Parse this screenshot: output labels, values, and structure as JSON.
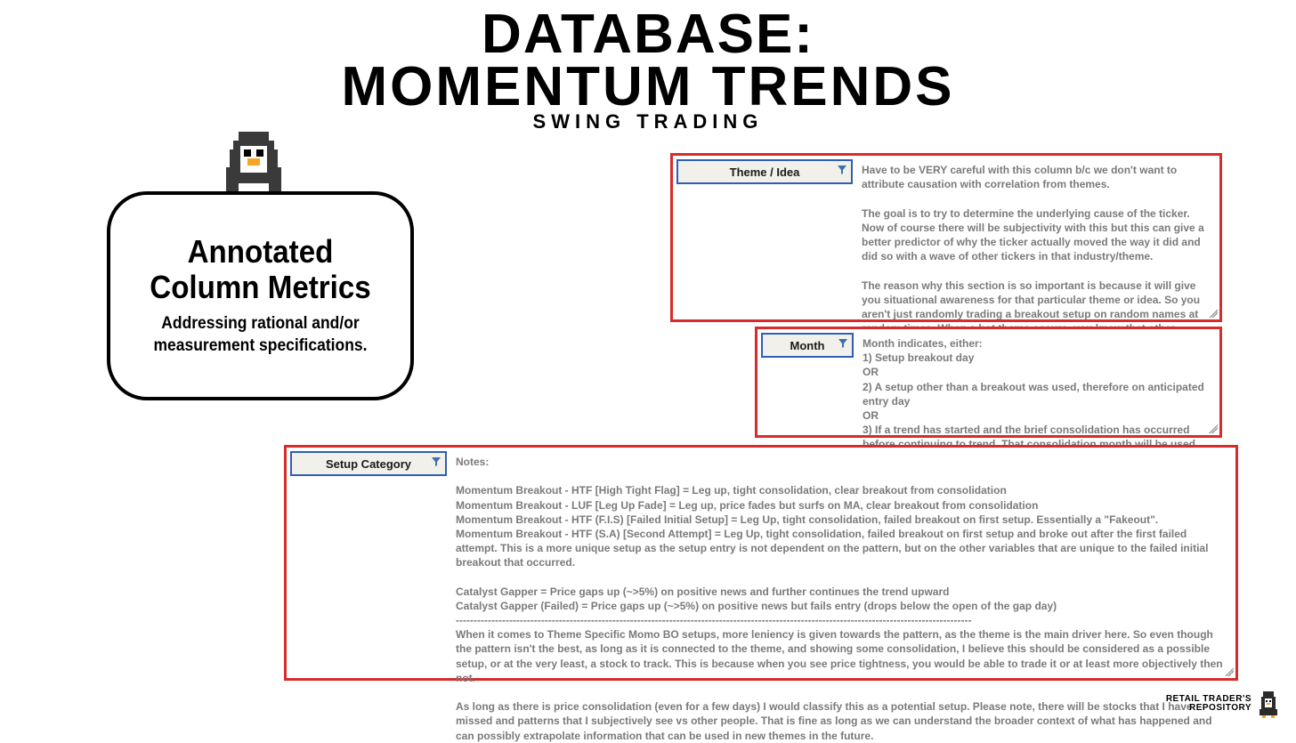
{
  "title": {
    "line1": "DATABASE:",
    "line2": "MOMENTUM TRENDS",
    "subtitle": "SWING TRADING"
  },
  "bubble": {
    "heading": "Annotated Column Metrics",
    "sub": "Addressing rational and/or measurement specifications."
  },
  "panels": {
    "theme": {
      "header": "Theme / Idea",
      "body": "Have to be VERY careful with this column b/c we don't want to attribute causation with correlation from themes.\n\nThe goal is to try to determine the underlying cause of the ticker. Now of course there will be subjectivity with this but this can give a better predictor of why the ticker actually moved the way it did and did so with a wave of other tickers in that industry/theme.\n\nThe reason why this section is so important is because it will give you situational awareness for that particular theme or idea. So you aren't just randomly trading a breakout setup on random names at random times. When a hot theme occurs, you know that other tickers in that theme are likely to move which can allow you to filter out a lot of the noise (false breakouts for example)."
    },
    "month": {
      "header": "Month",
      "body": "Month indicates, either:\n1) Setup breakout day\nOR\n2) A setup other than a breakout was used, therefore on anticipated entry day\nOR\n3) If a trend has started and the brief consolidation has occurred before continuing to trend. That consolidation month will be used.\neg. Price bounces off of a moving average clearly as a trend in present (pullback play)"
    },
    "setup": {
      "header": "Setup Category",
      "body": "Notes:\n\nMomentum Breakout - HTF [High Tight Flag] = Leg up, tight consolidation, clear breakout from consolidation\nMomentum Breakout - LUF [Leg Up Fade] = Leg up, price fades but surfs on MA, clear breakout from consolidation\nMomentum Breakout - HTF (F.I.S) [Failed Initial Setup] = Leg Up, tight consolidation, failed breakout on first setup. Essentially a \"Fakeout\".\nMomentum Breakout - HTF (S.A) [Second Attempt] = Leg Up, tight consolidation, failed breakout on first setup and broke out after the first failed attempt. This is a more unique setup as the setup entry is not dependent on the pattern, but on the other variables that are unique to the failed initial breakout that occurred.\n\nCatalyst Gapper = Price gaps up (~>5%) on positive news and further continues the trend upward\nCatalyst Gapper (Failed) = Price gaps up (~>5%) on positive news but fails entry (drops below the open of the gap day)\n-------------------------------------------------------------------------------------------------------------------------------------------------\nWhen it comes to Theme Specific Momo BO setups, more leniency is given towards the pattern, as the theme is the main driver here. So even though the pattern isn't the best, as long as it is connected to the theme, and showing some consolidation, I believe this should be considered as a possible setup, or at the very least, a stock to track. This is because when you see price tightness, you would be able to trade it or at least more objectively then not.\n\nAs long as there is price consolidation (even for a few days) I would classify this as a potential setup. Please note, there will be stocks that I have missed and patterns that I subjectively see vs other people. That is fine as long as we can understand the broader context of what has happened and can possibly extrapolate information that can be used in new themes in the future."
    }
  },
  "footer": {
    "line1": "RETAIL TRADER'S",
    "line2": "REPOSITORY"
  }
}
